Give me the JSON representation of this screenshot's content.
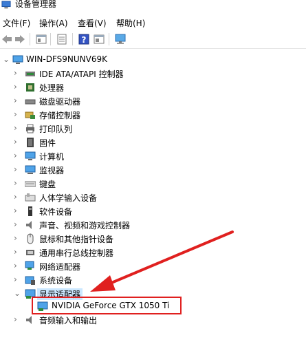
{
  "window": {
    "title": "设备管理器"
  },
  "menu": [
    {
      "label": "文件(F)"
    },
    {
      "label": "操作(A)"
    },
    {
      "label": "查看(V)"
    },
    {
      "label": "帮助(H)"
    }
  ],
  "toolbar": {
    "buttons": [
      "back-icon",
      "forward-icon",
      "properties-icon",
      "update-driver-icon",
      "help-icon",
      "view-icon",
      "monitor-scan-icon"
    ]
  },
  "tree": {
    "root": "WIN-DFS9NUNV69K",
    "categories": [
      {
        "label": "IDE ATA/ATAPI 控制器",
        "icon": "ide-controller-icon"
      },
      {
        "label": "处理器",
        "icon": "processor-icon"
      },
      {
        "label": "磁盘驱动器",
        "icon": "disk-drive-icon"
      },
      {
        "label": "存储控制器",
        "icon": "storage-controller-icon"
      },
      {
        "label": "打印队列",
        "icon": "printer-icon"
      },
      {
        "label": "固件",
        "icon": "firmware-icon"
      },
      {
        "label": "计算机",
        "icon": "computer-icon"
      },
      {
        "label": "监视器",
        "icon": "monitor-icon"
      },
      {
        "label": "键盘",
        "icon": "keyboard-icon"
      },
      {
        "label": "人体学输入设备",
        "icon": "hid-icon"
      },
      {
        "label": "软件设备",
        "icon": "software-device-icon"
      },
      {
        "label": "声音、视频和游戏控制器",
        "icon": "audio-icon"
      },
      {
        "label": "鼠标和其他指针设备",
        "icon": "mouse-icon"
      },
      {
        "label": "通用串行总线控制器",
        "icon": "usb-icon"
      },
      {
        "label": "网络适配器",
        "icon": "network-adapter-icon"
      },
      {
        "label": "系统设备",
        "icon": "system-device-icon"
      },
      {
        "label": "显示适配器",
        "icon": "display-adapter-icon",
        "expanded": true,
        "selected": true
      },
      {
        "label": "NVIDIA GeForce GTX 1050 Ti",
        "icon": "gpu-icon",
        "child": true
      },
      {
        "label": "音频输入和输出",
        "icon": "audio-io-icon"
      }
    ]
  },
  "colors": {
    "highlight": "#cce8ff",
    "annotation_red": "#e0201f"
  }
}
